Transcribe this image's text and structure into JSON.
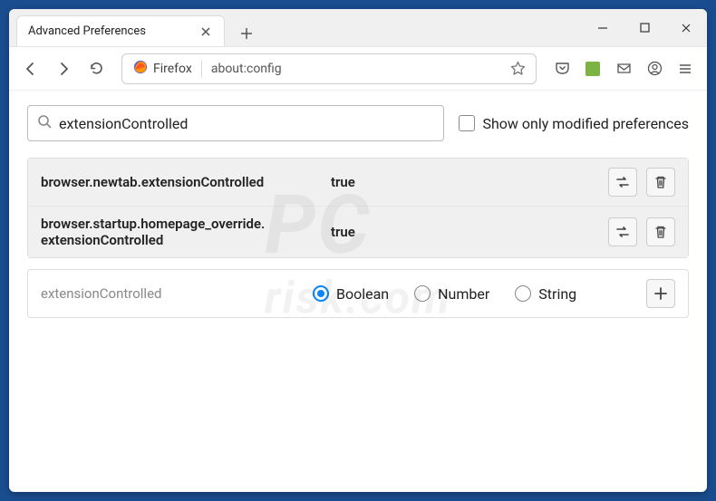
{
  "titlebar": {
    "tab_title": "Advanced Preferences"
  },
  "toolbar": {
    "identity_label": "Firefox",
    "url": "about:config"
  },
  "search": {
    "value": "extensionControlled",
    "show_modified_label": "Show only modified preferences"
  },
  "prefs": [
    {
      "name": "browser.newtab.extensionControlled",
      "value": "true"
    },
    {
      "name": "browser.startup.homepage_override.\nextensionControlled",
      "value": "true"
    }
  ],
  "new_pref": {
    "name": "extensionControlled",
    "types": [
      "Boolean",
      "Number",
      "String"
    ],
    "selected": "Boolean"
  }
}
